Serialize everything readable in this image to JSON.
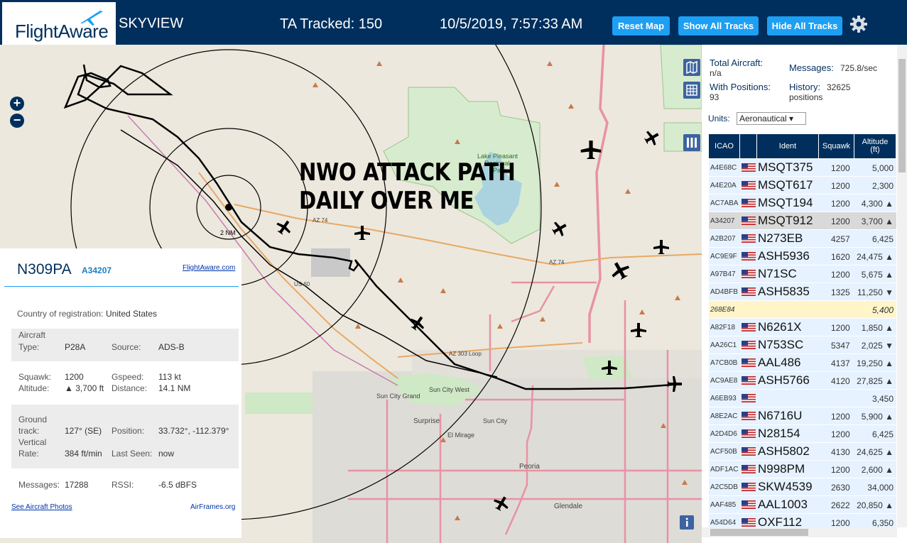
{
  "header": {
    "logo": "FlightAware",
    "title": "SKYVIEW",
    "ta_tracked": "TA Tracked: 150",
    "datetime": "10/5/2019, 7:57:33 AM",
    "reset_map": "Reset Map",
    "show_all_tracks": "Show All Tracks",
    "hide_all_tracks": "Hide All Tracks",
    "settings_icon": "gear-icon"
  },
  "map": {
    "overlay_line1": "NWO ATTACK PATH",
    "overlay_line2": "DAILY OVER ME",
    "zoom_in": "+",
    "zoom_out": "−",
    "range_ring_label": "2 NM",
    "labels": {
      "lake_pleasant_1": "Lake Pleasant",
      "lake_pleasant_2": "Regional",
      "lake_pleasant_3": "Park",
      "az74_a": "AZ 74",
      "az74_b": "AZ 74",
      "us60": "US 60",
      "az303": "AZ 303 Loop",
      "sun_city_grand": "Sun City Grand",
      "sun_city_west": "Sun City West",
      "sun_city": "Sun City",
      "surprise": "Surprise",
      "el_mirage": "El Mirage",
      "peoria": "Peoria",
      "glendale": "Glendale"
    },
    "colors": {
      "land": "#ece8dd",
      "park": "#cfe8c5",
      "water": "#aad3df",
      "urban": "#dedcd7",
      "road": "#e892a2",
      "highway": "#e8a866"
    }
  },
  "info": {
    "callsign": "N309PA",
    "icao": "A34207",
    "fa_link": "FlightAware.com",
    "country_label": "Country of registration:",
    "country": "United States",
    "aircraft_type_label_1": "Aircraft",
    "aircraft_type_label_2": "Type:",
    "aircraft_type": "P28A",
    "source_label": "Source:",
    "source": "ADS-B",
    "squawk_label": "Squawk:",
    "squawk": "1200",
    "gspeed_label": "Gspeed:",
    "gspeed": "113 kt",
    "altitude_label": "Altitude:",
    "altitude": "▲ 3,700 ft",
    "distance_label": "Distance:",
    "distance": "14.1 NM",
    "ground_label_1": "Ground",
    "ground_label_2": "track:",
    "ground_track": "127° (SE)",
    "position_label": "Position:",
    "position": "33.732°, -112.379°",
    "vertical_label_1": "Vertical",
    "vertical_label_2": "Rate:",
    "vertical_rate": "384 ft/min",
    "last_seen_label": "Last Seen:",
    "last_seen": "now",
    "messages_label": "Messages:",
    "messages": "17288",
    "rssi_label": "RSSI:",
    "rssi": "-6.5 dBFS",
    "photos_link": "See Aircraft Photos",
    "airframes_link": "AirFrames.org"
  },
  "stats": {
    "total_aircraft_label": "Total Aircraft:",
    "total_aircraft": "n/a",
    "with_positions_label": "With Positions:",
    "with_positions": "93",
    "messages_label": "Messages:",
    "messages": "725.8/sec",
    "history_label": "History:",
    "history_1": "32625",
    "history_2": "positions",
    "units_label": "Units:",
    "units_value": "Aeronautical ▾"
  },
  "table": {
    "headers": {
      "icao": "ICAO",
      "ident": "Ident",
      "squawk": "Squawk",
      "altitude_1": "Altitude",
      "altitude_2": "(ft)"
    },
    "rows": [
      {
        "icao": "A4E68C",
        "flag": true,
        "ident": "MSQT375",
        "squawk": "1200",
        "alt": "5,000"
      },
      {
        "icao": "A4E20A",
        "flag": true,
        "ident": "MSQT617",
        "squawk": "1200",
        "alt": "2,300"
      },
      {
        "icao": "AC7ABA",
        "flag": true,
        "ident": "MSQT194",
        "squawk": "1200",
        "alt": "4,300 ▲"
      },
      {
        "icao": "A34207",
        "flag": true,
        "ident": "MSQT912",
        "squawk": "1200",
        "alt": "3,700 ▲",
        "selected": true
      },
      {
        "icao": "A2B207",
        "flag": true,
        "ident": "N273EB",
        "squawk": "4257",
        "alt": "6,425"
      },
      {
        "icao": "AC9E9F",
        "flag": true,
        "ident": "ASH5936",
        "squawk": "1620",
        "alt": "24,475 ▲"
      },
      {
        "icao": "A97B47",
        "flag": true,
        "ident": "N71SC",
        "squawk": "1200",
        "alt": "5,675 ▲"
      },
      {
        "icao": "AD4BFB",
        "flag": true,
        "ident": "ASH5835",
        "squawk": "1325",
        "alt": "11,250 ▼"
      },
      {
        "icao": "268E84",
        "flag": false,
        "ident": "",
        "squawk": "",
        "alt": "5,400",
        "noposition": true
      },
      {
        "icao": "A82F18",
        "flag": true,
        "ident": "N6261X",
        "squawk": "1200",
        "alt": "1,850 ▲"
      },
      {
        "icao": "AA26C1",
        "flag": true,
        "ident": "N753SC",
        "squawk": "5347",
        "alt": "2,025 ▼"
      },
      {
        "icao": "A7CB0B",
        "flag": true,
        "ident": "AAL486",
        "squawk": "4137",
        "alt": "19,250 ▲"
      },
      {
        "icao": "AC9AE8",
        "flag": true,
        "ident": "ASH5766",
        "squawk": "4120",
        "alt": "27,825 ▲"
      },
      {
        "icao": "A6EB93",
        "flag": true,
        "ident": "",
        "squawk": "",
        "alt": "3,450"
      },
      {
        "icao": "A8E2AC",
        "flag": true,
        "ident": "N6716U",
        "squawk": "1200",
        "alt": "5,900 ▲"
      },
      {
        "icao": "A2D4D6",
        "flag": true,
        "ident": "N28154",
        "squawk": "1200",
        "alt": "6,425"
      },
      {
        "icao": "ACF50B",
        "flag": true,
        "ident": "ASH5802",
        "squawk": "4130",
        "alt": "24,625 ▲"
      },
      {
        "icao": "ADF1AC",
        "flag": true,
        "ident": "N998PM",
        "squawk": "1200",
        "alt": "2,600 ▲"
      },
      {
        "icao": "A2C5DB",
        "flag": true,
        "ident": "SKW4539",
        "squawk": "2630",
        "alt": "34,000"
      },
      {
        "icao": "AAF485",
        "flag": true,
        "ident": "AAL1003",
        "squawk": "2622",
        "alt": "20,850 ▲"
      },
      {
        "icao": "A54D64",
        "flag": true,
        "ident": "OXF112",
        "squawk": "1200",
        "alt": "6,350"
      }
    ]
  }
}
